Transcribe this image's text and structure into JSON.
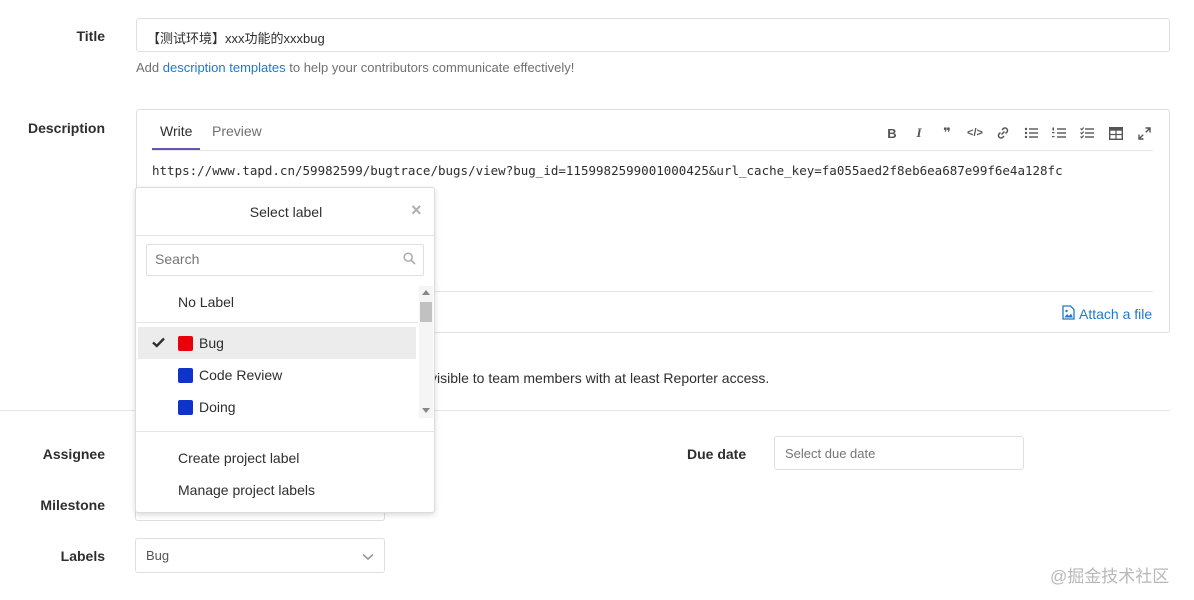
{
  "title_field": {
    "label": "Title",
    "value": "【测试环境】xxx功能的xxxbug",
    "hint_prefix": "Add",
    "hint_link": "description templates",
    "hint_suffix": "to help your contributors communicate effectively!"
  },
  "description": {
    "label": "Description",
    "tabs": [
      {
        "label": "Write",
        "active": true
      },
      {
        "label": "Preview",
        "active": false
      }
    ],
    "toolbar": {
      "bold": "B",
      "italic": "I",
      "quote": "❞",
      "code": "</>",
      "link": "🔗",
      "bullet_list": "☰",
      "numbered_list": "≡",
      "task_list": "☑",
      "table": "⊞",
      "fullscreen": "⤢"
    },
    "body": "https://www.tapd.cn/59982599/bugtrace/bugs/view?bug_id=1159982599001000425&url_cache_key=fa055aed2f8eb6ea687e99f6e4a128fc",
    "attach_label": "Attach a file"
  },
  "confidential_note": "visible to team members with at least Reporter access.",
  "assignee": {
    "label": "Assignee"
  },
  "milestone": {
    "label": "Milestone"
  },
  "labels": {
    "label": "Labels",
    "value": "Bug"
  },
  "due_date": {
    "label": "Due date",
    "placeholder": "Select due date"
  },
  "label_dropdown": {
    "title": "Select label",
    "close": "×",
    "search_placeholder": "Search",
    "no_label": "No Label",
    "items": [
      {
        "name": "Bug",
        "color": "#e8000b",
        "checked": true
      },
      {
        "name": "Code Review",
        "color": "#1033c8",
        "checked": false
      },
      {
        "name": "Doing",
        "color": "#1033c8",
        "checked": false
      }
    ],
    "footer": [
      "Create project label",
      "Manage project labels"
    ]
  },
  "colors": {
    "link": "#1f78d1",
    "tab_active_underline": "#6b4fbb"
  },
  "watermark": "@掘金技术社区"
}
